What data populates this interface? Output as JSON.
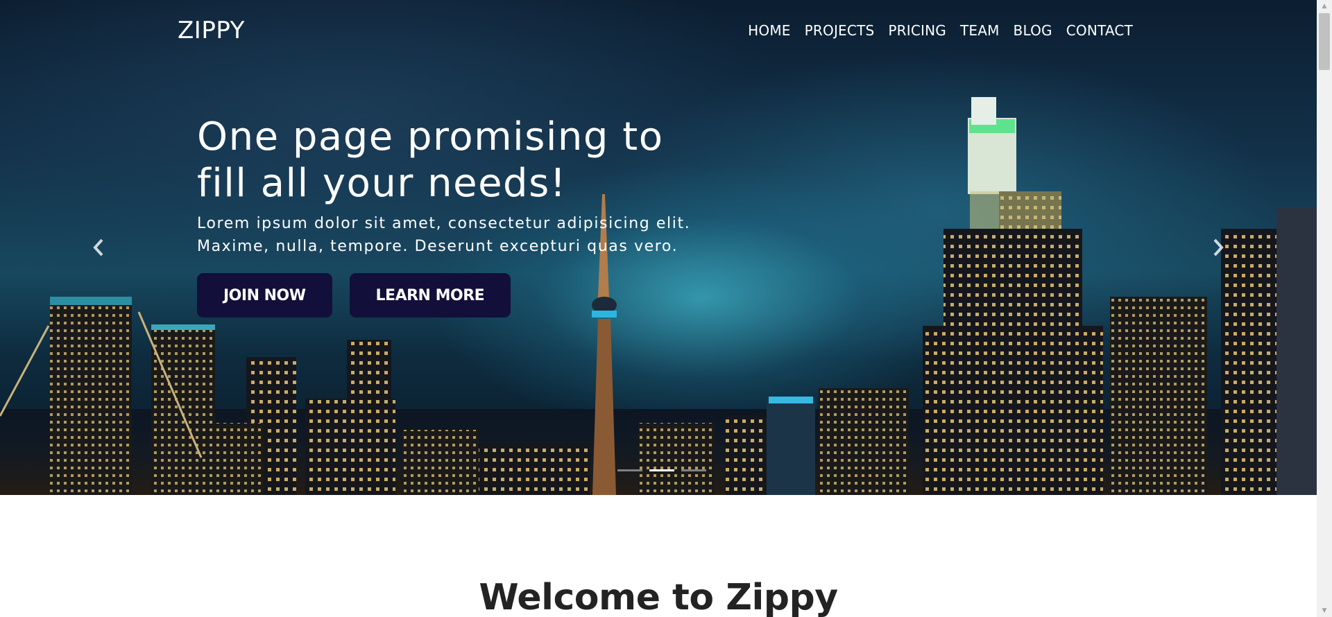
{
  "navbar": {
    "brand": "ZIPPY",
    "links": [
      "HOME",
      "PROJECTS",
      "PRICING",
      "TEAM",
      "BLOG",
      "CONTACT"
    ]
  },
  "hero": {
    "headline": "One page promising to fill all your needs!",
    "lead": "Lorem ipsum dolor sit amet, consectetur adipisicing elit. Maxime, nulla, tempore. Deserunt excepturi quas vero.",
    "buttons": {
      "join": "JOIN NOW",
      "learn": "LEARN MORE"
    },
    "carousel": {
      "prev_icon": "chevron-left-icon",
      "next_icon": "chevron-right-icon",
      "active_slide": 2,
      "slide_count": 3
    }
  },
  "welcome": {
    "title": "Welcome to Zippy"
  },
  "colors": {
    "button_bg": "#120f3a",
    "hero_tint": "#17485f",
    "heading_text": "#232323"
  }
}
